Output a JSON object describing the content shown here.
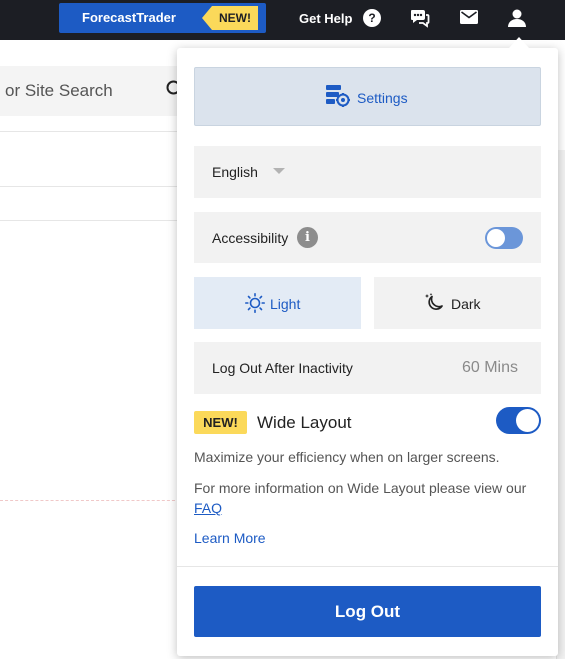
{
  "topbar": {
    "forecast_trader_label": "ForecastTrader",
    "forecast_trader_badge": "NEW!",
    "get_help_label": "Get Help",
    "help_icon_glyph": "?"
  },
  "background": {
    "search_placeholder": "or Site Search"
  },
  "panel": {
    "settings_label": "Settings",
    "language_value": "English",
    "accessibility_label": "Accessibility",
    "accessibility_info_glyph": "i",
    "theme_light_label": "Light",
    "theme_dark_label": "Dark",
    "logout_inactivity_label": "Log Out After Inactivity",
    "logout_inactivity_value": "60 Mins",
    "wide_layout_badge": "NEW!",
    "wide_layout_title": "Wide Layout",
    "wide_layout_desc": "Maximize your efficiency when on larger screens.",
    "wide_layout_info_prefix": "For more information on Wide Layout please view our",
    "wide_layout_faq_link": " FAQ",
    "learn_more_label": "Learn More",
    "logout_button_label": "Log Out"
  },
  "state": {
    "accessibility_enabled": false,
    "wide_layout_enabled": true,
    "theme_selected": "Light"
  },
  "colors": {
    "brand_blue": "#1d5bc4",
    "topbar_bg": "#1c1e24",
    "new_badge": "#fbd95a"
  },
  "icons": {
    "settings": "settings-gear-icon",
    "sun": "sun-icon",
    "moon": "moon-icon",
    "chat": "chat-icon",
    "mail": "mail-icon",
    "user": "user-icon",
    "search": "search-icon"
  }
}
